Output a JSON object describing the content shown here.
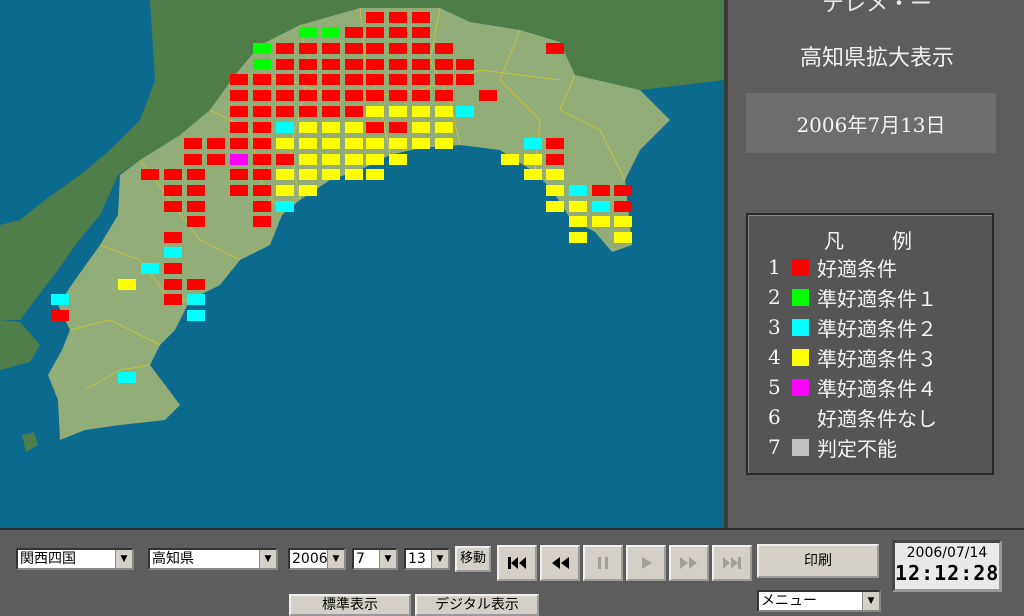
{
  "header": {
    "title_partial": "テレメ・ー",
    "view_title": "高知県拡大表示"
  },
  "date_display": "2006年7月13日",
  "legend": {
    "title_left": "凡",
    "title_right": "例",
    "items": [
      {
        "num": "1",
        "label": "好適条件",
        "color": "#ff0000"
      },
      {
        "num": "2",
        "label": "準好適条件１",
        "color": "#00ff00"
      },
      {
        "num": "3",
        "label": "準好適条件２",
        "color": "#00ffff"
      },
      {
        "num": "4",
        "label": "準好適条件３",
        "color": "#ffff00"
      },
      {
        "num": "5",
        "label": "準好適条件４",
        "color": "#ff00ff"
      },
      {
        "num": "6",
        "label": "好適条件なし",
        "color": ""
      },
      {
        "num": "7",
        "label": "判定不能",
        "color": "#c0c0c0"
      }
    ]
  },
  "controls": {
    "region": "関西四国",
    "prefecture": "高知県",
    "year": "2006",
    "month": "7",
    "day": "13",
    "move_label": "移動",
    "print_label": "印刷",
    "standard_label": "標準表示",
    "digital_label": "デジタル表示",
    "menu": "メニュー"
  },
  "clock": {
    "date": "2006/07/14",
    "time": "12:12:28"
  },
  "colors": {
    "map_sea": "#0b6a8d",
    "land_main": "#93ad78",
    "land_other": "#4f7d4a",
    "panel": "#5d5d5d"
  },
  "map_cells": [
    [
      "r",
      375,
      17
    ],
    [
      "r",
      398,
      17
    ],
    [
      "r",
      421,
      17
    ],
    [
      "g",
      308,
      32
    ],
    [
      "g",
      331,
      32
    ],
    [
      "r",
      354,
      32
    ],
    [
      "r",
      375,
      32
    ],
    [
      "r",
      398,
      32
    ],
    [
      "r",
      421,
      32
    ],
    [
      "g",
      262,
      48
    ],
    [
      "r",
      285,
      48
    ],
    [
      "r",
      308,
      48
    ],
    [
      "r",
      331,
      48
    ],
    [
      "r",
      354,
      48
    ],
    [
      "r",
      375,
      48
    ],
    [
      "r",
      398,
      48
    ],
    [
      "r",
      421,
      48
    ],
    [
      "r",
      444,
      48
    ],
    [
      "r",
      555,
      48
    ],
    [
      "g",
      262,
      64
    ],
    [
      "r",
      285,
      64
    ],
    [
      "r",
      308,
      64
    ],
    [
      "r",
      331,
      64
    ],
    [
      "r",
      354,
      64
    ],
    [
      "r",
      375,
      64
    ],
    [
      "r",
      398,
      64
    ],
    [
      "r",
      421,
      64
    ],
    [
      "r",
      444,
      64
    ],
    [
      "r",
      465,
      64
    ],
    [
      "r",
      239,
      79
    ],
    [
      "r",
      262,
      79
    ],
    [
      "r",
      285,
      79
    ],
    [
      "r",
      308,
      79
    ],
    [
      "r",
      331,
      79
    ],
    [
      "r",
      354,
      79
    ],
    [
      "r",
      375,
      79
    ],
    [
      "r",
      398,
      79
    ],
    [
      "r",
      421,
      79
    ],
    [
      "r",
      444,
      79
    ],
    [
      "r",
      465,
      79
    ],
    [
      "r",
      239,
      95
    ],
    [
      "r",
      262,
      95
    ],
    [
      "r",
      285,
      95
    ],
    [
      "r",
      308,
      95
    ],
    [
      "r",
      331,
      95
    ],
    [
      "r",
      354,
      95
    ],
    [
      "r",
      375,
      95
    ],
    [
      "r",
      398,
      95
    ],
    [
      "r",
      421,
      95
    ],
    [
      "r",
      444,
      95
    ],
    [
      "r",
      488,
      95
    ],
    [
      "r",
      239,
      111
    ],
    [
      "r",
      262,
      111
    ],
    [
      "r",
      285,
      111
    ],
    [
      "r",
      308,
      111
    ],
    [
      "r",
      331,
      111
    ],
    [
      "r",
      354,
      111
    ],
    [
      "y",
      375,
      111
    ],
    [
      "y",
      398,
      111
    ],
    [
      "y",
      421,
      111
    ],
    [
      "y",
      444,
      111
    ],
    [
      "c",
      465,
      111
    ],
    [
      "r",
      239,
      127
    ],
    [
      "r",
      262,
      127
    ],
    [
      "c",
      285,
      127
    ],
    [
      "y",
      308,
      127
    ],
    [
      "y",
      331,
      127
    ],
    [
      "y",
      354,
      127
    ],
    [
      "r",
      375,
      127
    ],
    [
      "r",
      398,
      127
    ],
    [
      "y",
      421,
      127
    ],
    [
      "y",
      444,
      127
    ],
    [
      "r",
      193,
      143
    ],
    [
      "r",
      216,
      143
    ],
    [
      "r",
      239,
      143
    ],
    [
      "r",
      262,
      143
    ],
    [
      "y",
      285,
      143
    ],
    [
      "y",
      308,
      143
    ],
    [
      "y",
      331,
      143
    ],
    [
      "y",
      354,
      143
    ],
    [
      "y",
      375,
      143
    ],
    [
      "y",
      398,
      143
    ],
    [
      "y",
      421,
      143
    ],
    [
      "y",
      444,
      143
    ],
    [
      "c",
      533,
      143
    ],
    [
      "r",
      555,
      143
    ],
    [
      "r",
      193,
      159
    ],
    [
      "r",
      216,
      159
    ],
    [
      "m",
      239,
      159
    ],
    [
      "r",
      262,
      159
    ],
    [
      "r",
      285,
      159
    ],
    [
      "y",
      308,
      159
    ],
    [
      "y",
      331,
      159
    ],
    [
      "y",
      354,
      159
    ],
    [
      "y",
      375,
      159
    ],
    [
      "y",
      398,
      159
    ],
    [
      "y",
      510,
      159
    ],
    [
      "y",
      533,
      159
    ],
    [
      "r",
      555,
      159
    ],
    [
      "r",
      150,
      174
    ],
    [
      "r",
      173,
      174
    ],
    [
      "r",
      196,
      174
    ],
    [
      "r",
      239,
      174
    ],
    [
      "r",
      262,
      174
    ],
    [
      "y",
      285,
      174
    ],
    [
      "y",
      308,
      174
    ],
    [
      "y",
      331,
      174
    ],
    [
      "y",
      354,
      174
    ],
    [
      "y",
      375,
      174
    ],
    [
      "y",
      533,
      174
    ],
    [
      "y",
      555,
      174
    ],
    [
      "r",
      173,
      190
    ],
    [
      "r",
      196,
      190
    ],
    [
      "r",
      239,
      190
    ],
    [
      "r",
      262,
      190
    ],
    [
      "y",
      285,
      190
    ],
    [
      "y",
      308,
      190
    ],
    [
      "y",
      555,
      190
    ],
    [
      "c",
      578,
      190
    ],
    [
      "r",
      601,
      190
    ],
    [
      "r",
      623,
      190
    ],
    [
      "r",
      173,
      206
    ],
    [
      "r",
      196,
      206
    ],
    [
      "r",
      262,
      206
    ],
    [
      "c",
      285,
      206
    ],
    [
      "y",
      555,
      206
    ],
    [
      "y",
      578,
      206
    ],
    [
      "c",
      601,
      206
    ],
    [
      "r",
      623,
      206
    ],
    [
      "r",
      196,
      221
    ],
    [
      "r",
      262,
      221
    ],
    [
      "y",
      578,
      221
    ],
    [
      "y",
      601,
      221
    ],
    [
      "y",
      623,
      221
    ],
    [
      "r",
      173,
      237
    ],
    [
      "y",
      578,
      237
    ],
    [
      "y",
      623,
      237
    ],
    [
      "c",
      173,
      252
    ],
    [
      "c",
      150,
      268
    ],
    [
      "r",
      173,
      268
    ],
    [
      "y",
      127,
      284
    ],
    [
      "r",
      173,
      284
    ],
    [
      "r",
      196,
      284
    ],
    [
      "c",
      60,
      299
    ],
    [
      "r",
      173,
      299
    ],
    [
      "c",
      196,
      299
    ],
    [
      "r",
      60,
      315
    ],
    [
      "c",
      196,
      315
    ],
    [
      "c",
      127,
      377
    ]
  ]
}
